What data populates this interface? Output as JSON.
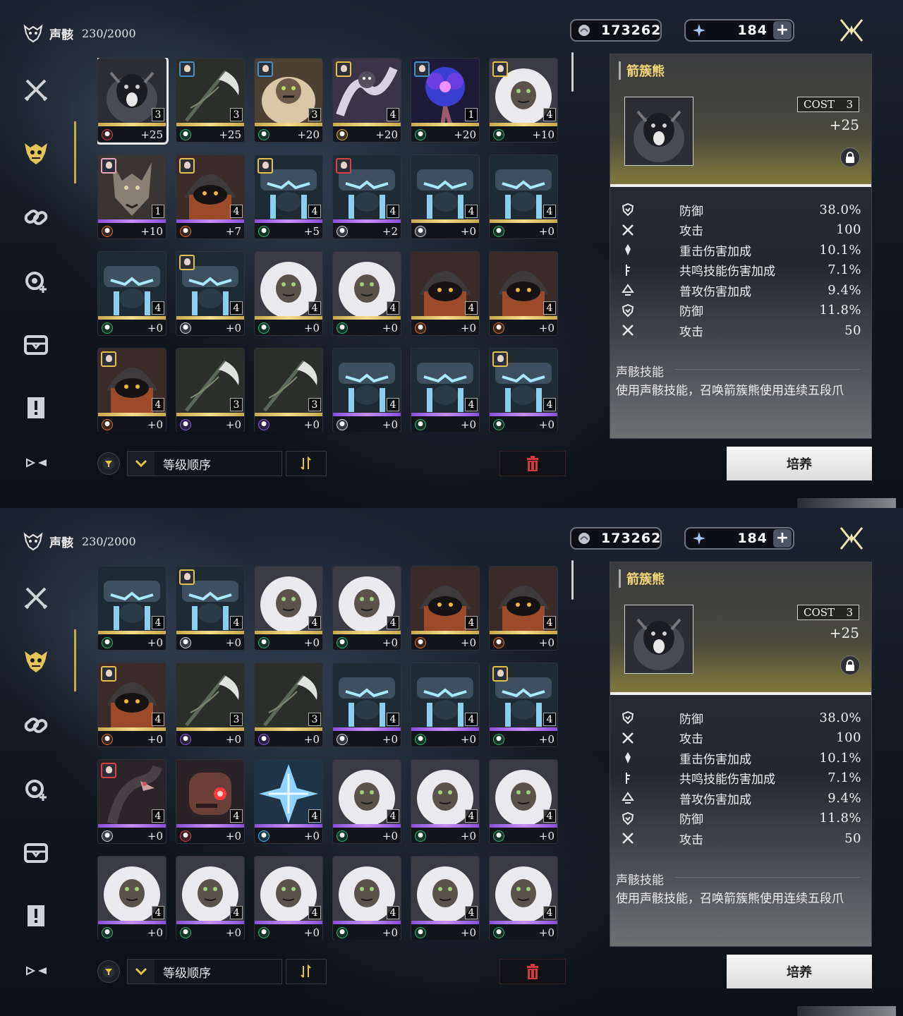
{
  "header": {
    "title": "声骸",
    "count": "230/2000"
  },
  "currency": {
    "shell_credits": "173262",
    "astrite": "184",
    "plus_label": "+"
  },
  "sidebar": {
    "items": [
      {
        "id": "weapon",
        "icon": "crossed-swords-icon"
      },
      {
        "id": "echo",
        "icon": "demon-mask-icon",
        "active": true
      },
      {
        "id": "material",
        "icon": "chain-link-icon"
      },
      {
        "id": "development",
        "icon": "gear-plus-icon"
      },
      {
        "id": "supply",
        "icon": "box-icon"
      },
      {
        "id": "quest-item",
        "icon": "exclamation-icon"
      },
      {
        "id": "collapse",
        "icon": "collapse-arrows-icon"
      }
    ]
  },
  "sort": {
    "label": "等级顺序"
  },
  "detail": {
    "name": "箭簇熊",
    "cost_label": "COST",
    "cost_value": "3",
    "level": "+25",
    "stats": [
      {
        "icon": "defense-icon",
        "name": "防御",
        "value": "38.0%"
      },
      {
        "icon": "attack-icon",
        "name": "攻击",
        "value": "100"
      },
      {
        "icon": "heavy-attack-icon",
        "name": "重击伤害加成",
        "value": "10.1%"
      },
      {
        "icon": "resonance-skill-icon",
        "name": "共鸣技能伤害加成",
        "value": "7.1%"
      },
      {
        "icon": "basic-attack-icon",
        "name": "普攻伤害加成",
        "value": "9.4%"
      },
      {
        "icon": "defense-icon",
        "name": "防御",
        "value": "11.8%"
      },
      {
        "icon": "attack-icon",
        "name": "攻击",
        "value": "50"
      }
    ],
    "skill_title": "声骸技能",
    "skill_desc": "使用声骸技能，召唤箭簇熊使用连续五段爪"
  },
  "train_button": "培养",
  "colors": {
    "gold": "#c9a94d",
    "purple": "#a66be0",
    "name_gold": "#f1d77a",
    "sonata_red": "#d9404a",
    "sonata_green": "#2fb36b",
    "sonata_yellow": "#d8b334",
    "sonata_orange": "#e06d2b",
    "sonata_white": "#cfd6dd",
    "sonata_violet": "#8a5ad8",
    "sonata_cyan": "#4fb3e8",
    "trash_red": "#d23b3b"
  },
  "screens": [
    {
      "grid": [
        {
          "m": "bear",
          "cost": "3",
          "lvl": "+25",
          "son": "red",
          "rar": "gold",
          "eq": null,
          "sel": true
        },
        {
          "m": "scythe",
          "cost": "3",
          "lvl": "+25",
          "son": "green",
          "rar": "gold",
          "eq": "#4a90c8"
        },
        {
          "m": "ape",
          "cost": "3",
          "lvl": "+20",
          "son": "green",
          "rar": "gold",
          "eq": "#4a90c8"
        },
        {
          "m": "serpent",
          "cost": "4",
          "lvl": "+20",
          "son": "yellow",
          "rar": "gold",
          "eq": "#e2c04a"
        },
        {
          "m": "flower",
          "cost": "1",
          "lvl": "+20",
          "son": "green",
          "rar": "gold",
          "eq": "#4a90c8"
        },
        {
          "m": "whiteape",
          "cost": "4",
          "lvl": "+10",
          "son": "green",
          "rar": "gold",
          "eq": "#e2c04a"
        },
        {
          "m": "wolf",
          "cost": "1",
          "lvl": "+10",
          "son": "orange",
          "rar": "purple",
          "eq": "#e8a4c0"
        },
        {
          "m": "hood",
          "cost": "4",
          "lvl": "+7",
          "son": "orange",
          "rar": "purple",
          "eq": "#e2c04a"
        },
        {
          "m": "golem",
          "cost": "4",
          "lvl": "+5",
          "son": "green",
          "rar": "purple",
          "eq": "#e2c04a"
        },
        {
          "m": "golem",
          "cost": "4",
          "lvl": "+2",
          "son": "white",
          "rar": "purple",
          "eq": "#d94040"
        },
        {
          "m": "golem",
          "cost": "4",
          "lvl": "+0",
          "son": "white",
          "rar": "gold",
          "eq": null
        },
        {
          "m": "golem",
          "cost": "4",
          "lvl": "+0",
          "son": "green",
          "rar": "gold",
          "eq": null
        },
        {
          "m": "golem",
          "cost": "4",
          "lvl": "+0",
          "son": "green",
          "rar": "gold",
          "eq": null
        },
        {
          "m": "golem",
          "cost": "4",
          "lvl": "+0",
          "son": "white",
          "rar": "gold",
          "eq": "#e2c04a"
        },
        {
          "m": "whiteape",
          "cost": "4",
          "lvl": "+0",
          "son": "green",
          "rar": "gold",
          "eq": null
        },
        {
          "m": "whiteape",
          "cost": "4",
          "lvl": "+0",
          "son": "green",
          "rar": "gold",
          "eq": null
        },
        {
          "m": "hood",
          "cost": "4",
          "lvl": "+0",
          "son": "orange",
          "rar": "gold",
          "eq": null
        },
        {
          "m": "hood",
          "cost": "4",
          "lvl": "+0",
          "son": "orange",
          "rar": "gold",
          "eq": null
        },
        {
          "m": "hood",
          "cost": "4",
          "lvl": "+0",
          "son": "orange",
          "rar": "gold",
          "eq": "#e2c04a"
        },
        {
          "m": "scythe",
          "cost": "3",
          "lvl": "+0",
          "son": "violet",
          "rar": "gold",
          "eq": null
        },
        {
          "m": "scythe",
          "cost": "3",
          "lvl": "+0",
          "son": "violet",
          "rar": "gold",
          "eq": null
        },
        {
          "m": "golem",
          "cost": "4",
          "lvl": "+0",
          "son": "white",
          "rar": "purple",
          "eq": null
        },
        {
          "m": "golem",
          "cost": "4",
          "lvl": "+0",
          "son": "green",
          "rar": "purple",
          "eq": null
        },
        {
          "m": "golem",
          "cost": "4",
          "lvl": "+0",
          "son": "green",
          "rar": "purple",
          "eq": "#e2c04a"
        }
      ]
    },
    {
      "grid": [
        {
          "m": "golem",
          "cost": "4",
          "lvl": "+0",
          "son": "green",
          "rar": "gold",
          "eq": null
        },
        {
          "m": "golem",
          "cost": "4",
          "lvl": "+0",
          "son": "white",
          "rar": "gold",
          "eq": "#e2c04a"
        },
        {
          "m": "whiteape",
          "cost": "4",
          "lvl": "+0",
          "son": "green",
          "rar": "gold",
          "eq": null
        },
        {
          "m": "whiteape",
          "cost": "4",
          "lvl": "+0",
          "son": "green",
          "rar": "gold",
          "eq": null
        },
        {
          "m": "hood",
          "cost": "4",
          "lvl": "+0",
          "son": "orange",
          "rar": "gold",
          "eq": null
        },
        {
          "m": "hood",
          "cost": "4",
          "lvl": "+0",
          "son": "orange",
          "rar": "gold",
          "eq": null
        },
        {
          "m": "hood",
          "cost": "4",
          "lvl": "+0",
          "son": "orange",
          "rar": "gold",
          "eq": "#e2c04a"
        },
        {
          "m": "scythe",
          "cost": "3",
          "lvl": "+0",
          "son": "violet",
          "rar": "gold",
          "eq": null
        },
        {
          "m": "scythe",
          "cost": "3",
          "lvl": "+0",
          "son": "violet",
          "rar": "gold",
          "eq": null
        },
        {
          "m": "golem",
          "cost": "4",
          "lvl": "+0",
          "son": "white",
          "rar": "purple",
          "eq": null
        },
        {
          "m": "golem",
          "cost": "4",
          "lvl": "+0",
          "son": "green",
          "rar": "purple",
          "eq": null
        },
        {
          "m": "golem",
          "cost": "4",
          "lvl": "+0",
          "son": "green",
          "rar": "purple",
          "eq": "#e2c04a"
        },
        {
          "m": "dragon",
          "cost": "4",
          "lvl": "+0",
          "son": "white",
          "rar": "purple",
          "eq": "#d94040"
        },
        {
          "m": "robot",
          "cost": "4",
          "lvl": "+0",
          "son": "red",
          "rar": "purple",
          "eq": null
        },
        {
          "m": "ice",
          "cost": "4",
          "lvl": "+0",
          "son": "cyan",
          "rar": "purple",
          "eq": null
        },
        {
          "m": "whiteape",
          "cost": "4",
          "lvl": "+0",
          "son": "green",
          "rar": "purple",
          "eq": null
        },
        {
          "m": "whiteape",
          "cost": "4",
          "lvl": "+0",
          "son": "green",
          "rar": "purple",
          "eq": null
        },
        {
          "m": "whiteape",
          "cost": "4",
          "lvl": "+0",
          "son": "green",
          "rar": "purple",
          "eq": null
        },
        {
          "m": "whiteape",
          "cost": "4",
          "lvl": "+0",
          "son": "green",
          "rar": "purple",
          "eq": null
        },
        {
          "m": "whiteape",
          "cost": "4",
          "lvl": "+0",
          "son": "green",
          "rar": "purple",
          "eq": null
        },
        {
          "m": "whiteape",
          "cost": "4",
          "lvl": "+0",
          "son": "green",
          "rar": "purple",
          "eq": null
        },
        {
          "m": "whiteape",
          "cost": "4",
          "lvl": "+0",
          "son": "green",
          "rar": "purple",
          "eq": null
        },
        {
          "m": "whiteape",
          "cost": "4",
          "lvl": "+0",
          "son": "green",
          "rar": "purple",
          "eq": null
        },
        {
          "m": "whiteape",
          "cost": "4",
          "lvl": "+0",
          "son": "green",
          "rar": "purple",
          "eq": null
        }
      ]
    }
  ]
}
